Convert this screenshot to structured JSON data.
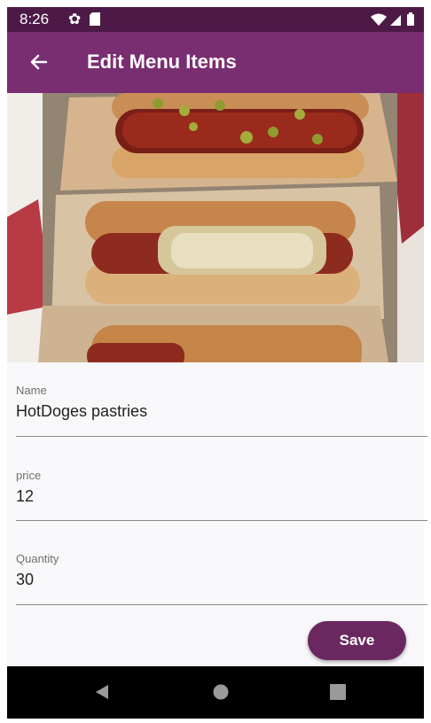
{
  "status": {
    "time": "8:26",
    "icons": [
      "gear-icon",
      "sdcard-icon",
      "wifi-icon",
      "signal-icon",
      "battery-icon"
    ]
  },
  "appbar": {
    "title": "Edit Menu Items",
    "back_icon": "arrow-left-icon",
    "color": "#7a2e72"
  },
  "form": {
    "fields": [
      {
        "label": "Name",
        "value": "HotDoges pastries"
      },
      {
        "label": "price",
        "value": "12"
      },
      {
        "label": "Quantity",
        "value": "30"
      }
    ],
    "save_label": "Save"
  },
  "navbar": {
    "icons": [
      "back-triangle-icon",
      "home-circle-icon",
      "recents-square-icon"
    ]
  },
  "colors": {
    "statusbar": "#4d1a47",
    "accent": "#6b2760",
    "form_bg": "#f8f8fa"
  }
}
